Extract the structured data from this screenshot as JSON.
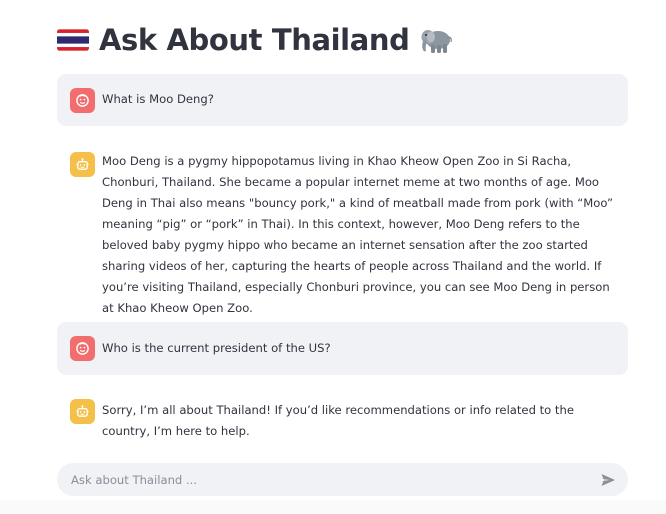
{
  "header": {
    "title": "Ask About Thailand",
    "flag_icon": "thailand-flag-icon",
    "elephant_icon": "elephant-icon"
  },
  "messages": [
    {
      "role": "user",
      "avatar_icon": "face-icon",
      "text": "What is Moo Deng?"
    },
    {
      "role": "assistant",
      "avatar_icon": "robot-icon",
      "text": "Moo Deng is a pygmy hippopotamus living in Khao Kheow Open Zoo in Si Racha, Chonburi, Thailand. She became a popular internet meme at two months of age. Moo Deng in Thai also means \"bouncy pork,\" a kind of meatball made from pork (with “Moo” meaning “pig” or “pork” in Thai). In this context, however, Moo Deng refers to the beloved baby pygmy hippo who became an internet sensation after the zoo started sharing videos of her, capturing the hearts of people across Thailand and the world. If you’re visiting Thailand, especially Chonburi province, you can see Moo Deng in person at Khao Kheow Open Zoo."
    },
    {
      "role": "user",
      "avatar_icon": "face-icon",
      "text": "Who is the current president of the US?"
    },
    {
      "role": "assistant",
      "avatar_icon": "robot-icon",
      "text": "Sorry, I’m all about Thailand! If you’d like recommendations or info related to the country, I’m here to help."
    }
  ],
  "chat_input": {
    "value": "",
    "placeholder": "Ask about Thailand ...",
    "send_icon": "send-icon"
  },
  "colors": {
    "user_bubble": "#f0f2f6",
    "user_avatar": "#f26d6d",
    "assistant_avatar": "#f5c04a",
    "text": "#31333f"
  }
}
